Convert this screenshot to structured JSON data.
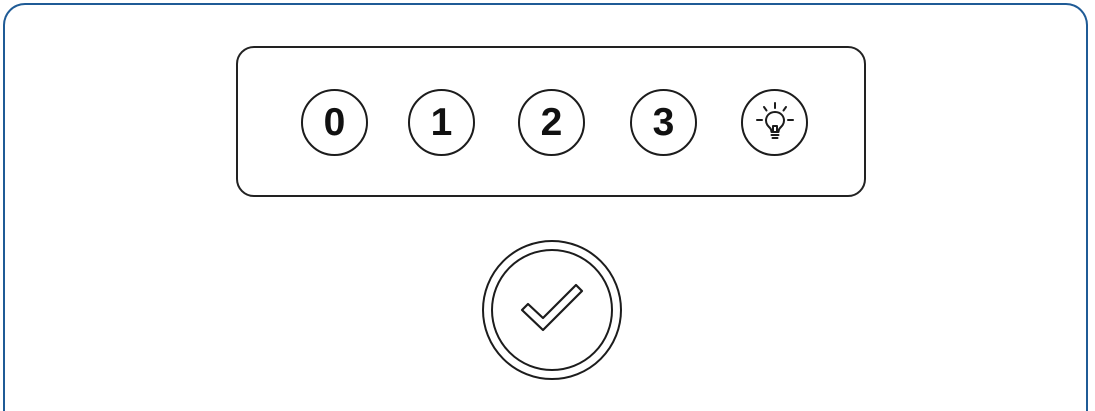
{
  "answer_options": [
    {
      "label": "0"
    },
    {
      "label": "1"
    },
    {
      "label": "2"
    },
    {
      "label": "3"
    }
  ],
  "hint_button": {
    "icon": "lightbulb-icon"
  },
  "submit_button": {
    "icon": "checkmark-icon"
  },
  "colors": {
    "frame_border": "#1f5b96",
    "outline": "#1c1c1c",
    "background": "#ffffff"
  }
}
